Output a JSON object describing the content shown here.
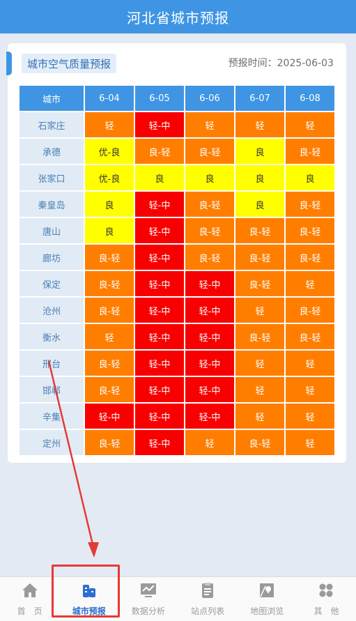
{
  "header": {
    "title": "河北省城市预报"
  },
  "card": {
    "title": "城市空气质量预报",
    "forecast_time": "预报时间：2025-06-03"
  },
  "table": {
    "city_header": "城市",
    "dates": [
      "6-04",
      "6-05",
      "6-06",
      "6-07",
      "6-08"
    ],
    "rows": [
      {
        "city": "石家庄",
        "cells": [
          {
            "v": "轻",
            "l": "orange"
          },
          {
            "v": "轻-中",
            "l": "red"
          },
          {
            "v": "轻",
            "l": "orange"
          },
          {
            "v": "轻",
            "l": "orange"
          },
          {
            "v": "轻",
            "l": "orange"
          }
        ]
      },
      {
        "city": "承德",
        "cells": [
          {
            "v": "优-良",
            "l": "yellow"
          },
          {
            "v": "良-轻",
            "l": "orange"
          },
          {
            "v": "良-轻",
            "l": "orange"
          },
          {
            "v": "良",
            "l": "yellow"
          },
          {
            "v": "良-轻",
            "l": "orange"
          }
        ]
      },
      {
        "city": "张家口",
        "cells": [
          {
            "v": "优-良",
            "l": "yellow"
          },
          {
            "v": "良",
            "l": "yellow"
          },
          {
            "v": "良",
            "l": "yellow"
          },
          {
            "v": "良",
            "l": "yellow"
          },
          {
            "v": "良",
            "l": "yellow"
          }
        ]
      },
      {
        "city": "秦皇岛",
        "cells": [
          {
            "v": "良",
            "l": "yellow"
          },
          {
            "v": "轻-中",
            "l": "red"
          },
          {
            "v": "良-轻",
            "l": "orange"
          },
          {
            "v": "良",
            "l": "yellow"
          },
          {
            "v": "良-轻",
            "l": "orange"
          }
        ]
      },
      {
        "city": "唐山",
        "cells": [
          {
            "v": "良",
            "l": "yellow"
          },
          {
            "v": "轻-中",
            "l": "red"
          },
          {
            "v": "良-轻",
            "l": "orange"
          },
          {
            "v": "良-轻",
            "l": "orange"
          },
          {
            "v": "良-轻",
            "l": "orange"
          }
        ]
      },
      {
        "city": "廊坊",
        "cells": [
          {
            "v": "良-轻",
            "l": "orange"
          },
          {
            "v": "轻-中",
            "l": "red"
          },
          {
            "v": "良-轻",
            "l": "orange"
          },
          {
            "v": "良-轻",
            "l": "orange"
          },
          {
            "v": "良-轻",
            "l": "orange"
          }
        ]
      },
      {
        "city": "保定",
        "cells": [
          {
            "v": "良-轻",
            "l": "orange"
          },
          {
            "v": "轻-中",
            "l": "red"
          },
          {
            "v": "轻-中",
            "l": "red"
          },
          {
            "v": "良-轻",
            "l": "orange"
          },
          {
            "v": "轻",
            "l": "orange"
          }
        ]
      },
      {
        "city": "沧州",
        "cells": [
          {
            "v": "良-轻",
            "l": "orange"
          },
          {
            "v": "轻-中",
            "l": "red"
          },
          {
            "v": "轻-中",
            "l": "red"
          },
          {
            "v": "轻",
            "l": "orange"
          },
          {
            "v": "良-轻",
            "l": "orange"
          }
        ]
      },
      {
        "city": "衡水",
        "cells": [
          {
            "v": "轻",
            "l": "orange"
          },
          {
            "v": "轻-中",
            "l": "red"
          },
          {
            "v": "轻-中",
            "l": "red"
          },
          {
            "v": "良-轻",
            "l": "orange"
          },
          {
            "v": "良-轻",
            "l": "orange"
          }
        ]
      },
      {
        "city": "邢台",
        "cells": [
          {
            "v": "良-轻",
            "l": "orange"
          },
          {
            "v": "轻-中",
            "l": "red"
          },
          {
            "v": "轻-中",
            "l": "red"
          },
          {
            "v": "轻",
            "l": "orange"
          },
          {
            "v": "轻",
            "l": "orange"
          }
        ]
      },
      {
        "city": "邯郸",
        "cells": [
          {
            "v": "良-轻",
            "l": "orange"
          },
          {
            "v": "轻-中",
            "l": "red"
          },
          {
            "v": "轻-中",
            "l": "red"
          },
          {
            "v": "轻",
            "l": "orange"
          },
          {
            "v": "轻",
            "l": "orange"
          }
        ]
      },
      {
        "city": "辛集",
        "cells": [
          {
            "v": "轻-中",
            "l": "red"
          },
          {
            "v": "轻-中",
            "l": "red"
          },
          {
            "v": "轻-中",
            "l": "red"
          },
          {
            "v": "轻",
            "l": "orange"
          },
          {
            "v": "轻",
            "l": "orange"
          }
        ]
      },
      {
        "city": "定州",
        "cells": [
          {
            "v": "良-轻",
            "l": "orange"
          },
          {
            "v": "轻-中",
            "l": "red"
          },
          {
            "v": "轻",
            "l": "orange"
          },
          {
            "v": "良-轻",
            "l": "orange"
          },
          {
            "v": "轻",
            "l": "orange"
          }
        ]
      }
    ]
  },
  "tabs": [
    {
      "label": "首　页",
      "icon": "home-icon",
      "active": false
    },
    {
      "label": "城市预报",
      "icon": "city-forecast-icon",
      "active": true
    },
    {
      "label": "数据分析",
      "icon": "data-analysis-icon",
      "active": false
    },
    {
      "label": "站点列表",
      "icon": "station-list-icon",
      "active": false
    },
    {
      "label": "地图浏览",
      "icon": "map-browse-icon",
      "active": false
    },
    {
      "label": "其　他",
      "icon": "more-icon",
      "active": false
    }
  ],
  "colors": {
    "orange": "#ff7e00",
    "red": "#f80000",
    "yellow": "#ffff00",
    "accent": "#3f95e3",
    "annotation": "#e53935"
  }
}
